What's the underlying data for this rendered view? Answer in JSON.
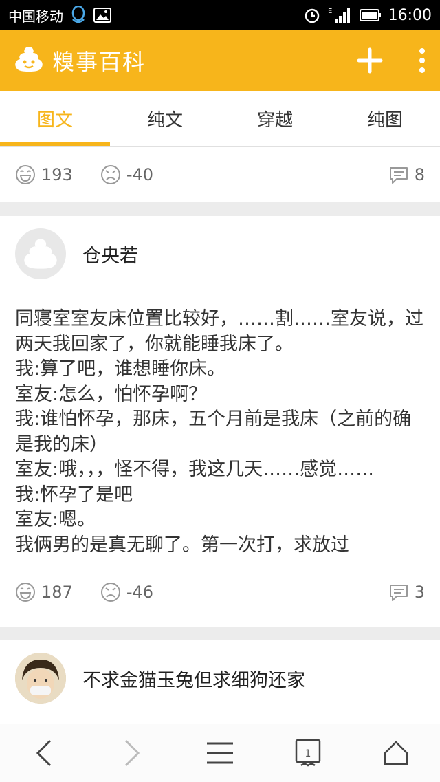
{
  "status_bar": {
    "carrier": "中国移动",
    "network": "E",
    "time": "16:00"
  },
  "app": {
    "title": "糗事百科",
    "brand_color": "#f7b51b"
  },
  "tabs": [
    {
      "label": "图文",
      "active": true
    },
    {
      "label": "纯文",
      "active": false
    },
    {
      "label": "穿越",
      "active": false
    },
    {
      "label": "纯图",
      "active": false
    }
  ],
  "posts": [
    {
      "partial": true,
      "up_count": "193",
      "down_count": "-40",
      "comment_count": "8"
    },
    {
      "username": "仓央若",
      "body": "同寝室室友床位置比较好，……割……室友说，过两天我回家了，你就能睡我床了。\n我:算了吧，谁想睡你床。\n室友:怎么，怕怀孕啊？\n我:谁怕怀孕，那床，五个月前是我床（之前的确是我的床）\n室友:哦，，，怪不得，我这几天……感觉……\n我:怀孕了是吧\n室友:嗯。\n我俩男的是真无聊了。第一次打，求放过",
      "up_count": "187",
      "down_count": "-46",
      "comment_count": "3"
    },
    {
      "username": "不求金猫玉兔但求细狗还家"
    }
  ],
  "bottom_nav": {
    "tabs_count": "1"
  }
}
